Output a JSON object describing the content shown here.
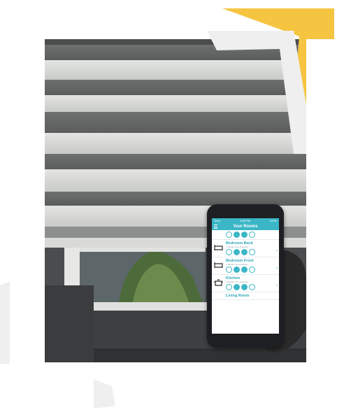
{
  "colors": {
    "accent": "#3bb6c6",
    "yellow": "#f5c542",
    "frame": "#f0f0f0"
  },
  "phone": {
    "status": {
      "left": "Telus",
      "center": "4:58 PM",
      "right": "100%"
    },
    "nav": {
      "title": "Your Rooms",
      "menu_icon": "hamburger-icon"
    },
    "rooms": [
      {
        "name": "Bedroom Back",
        "sub": "1 Shade | No schedules",
        "icon": "bed-icon"
      },
      {
        "name": "Bedroom Front",
        "sub": "1 Shade | No schedules",
        "icon": "bed-icon"
      },
      {
        "name": "Kitchen",
        "sub": "1 Shade | No schedules",
        "icon": "pot-icon"
      },
      {
        "name": "Living Room",
        "sub": "",
        "icon": ""
      }
    ]
  }
}
